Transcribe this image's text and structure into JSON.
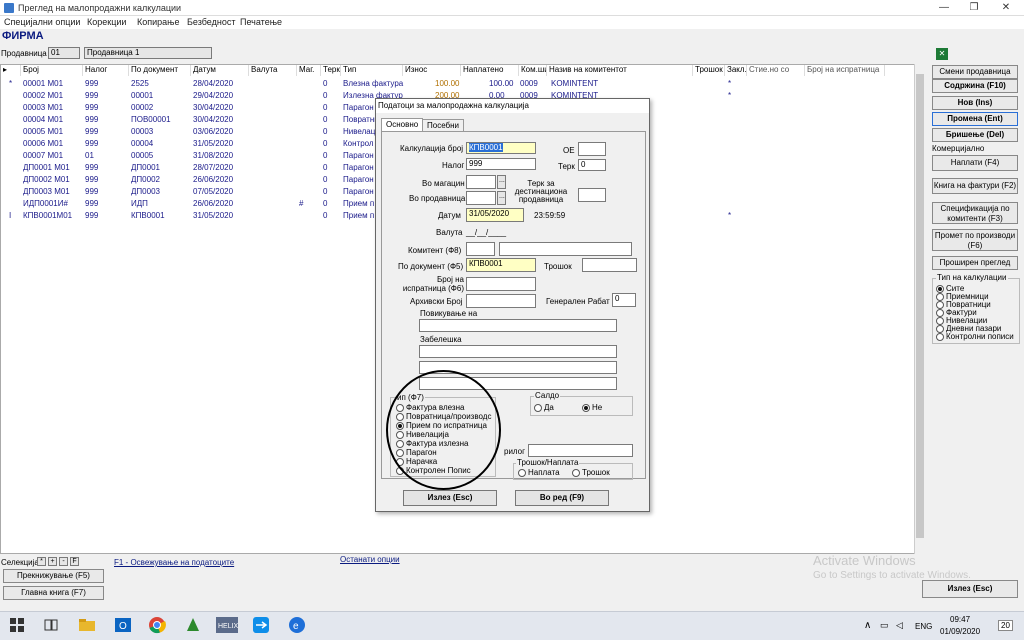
{
  "window": {
    "title": "Преглед на малопродажни калкулации",
    "minimize": "—",
    "maximize": "❐",
    "close": "✕"
  },
  "menu": [
    "Специјални опции",
    "Корекции",
    "Копирање",
    "Безбедност",
    "Печатење"
  ],
  "header": {
    "company": "ФИРМА",
    "store_label": "Продавница",
    "store_code": "01",
    "store_name": "Продавница 1"
  },
  "grid": {
    "columns": [
      "Број",
      "Налог",
      "По документ",
      "Датум",
      "Валута",
      "Маг.",
      "Терк",
      "Тип",
      "Износ",
      "Наплатено",
      "Ком.ши",
      "Назив на комитентот",
      "Трошок",
      "Закл.",
      "Стие.но со",
      "Број на испратница"
    ],
    "rows": [
      {
        "mark": "*",
        "broj": "00001 M01",
        "nalog": "999",
        "doc": "2525",
        "datum": "28/04/2020",
        "valuta": "",
        "mag": "",
        "terk": "0",
        "tip": "Влезна фактура",
        "iznos": "100.00",
        "naplateno": "100.00",
        "kom": "0009",
        "naziv": "KOMINTENT",
        "zakl": "*"
      },
      {
        "mark": "",
        "broj": "00002 M01",
        "nalog": "999",
        "doc": "00001",
        "datum": "29/04/2020",
        "valuta": "",
        "mag": "",
        "terk": "0",
        "tip": "Излезна фактур",
        "iznos": "200.00",
        "naplateno": "0.00",
        "kom": "0009",
        "naziv": "KOMINTENT",
        "zakl": "*"
      },
      {
        "mark": "",
        "broj": "00003 M01",
        "nalog": "999",
        "doc": "00002",
        "datum": "30/04/2020",
        "valuta": "",
        "mag": "",
        "terk": "0",
        "tip": "Парагон",
        "iznos": "",
        "naplateno": "",
        "kom": "",
        "naziv": "",
        "zakl": ""
      },
      {
        "mark": "",
        "broj": "00004 M01",
        "nalog": "999",
        "doc": "ПОВ00001",
        "datum": "30/04/2020",
        "valuta": "",
        "mag": "",
        "terk": "0",
        "tip": "Повратни",
        "iznos": "",
        "naplateno": "",
        "kom": "",
        "naziv": "",
        "zakl": ""
      },
      {
        "mark": "",
        "broj": "00005 M01",
        "nalog": "999",
        "doc": "00003",
        "datum": "03/06/2020",
        "valuta": "",
        "mag": "",
        "terk": "0",
        "tip": "Нивелаци",
        "iznos": "",
        "naplateno": "",
        "kom": "",
        "naziv": "",
        "zakl": ""
      },
      {
        "mark": "",
        "broj": "00006 M01",
        "nalog": "999",
        "doc": "00004",
        "datum": "31/05/2020",
        "valuta": "",
        "mag": "",
        "terk": "0",
        "tip": "Контрол",
        "iznos": "",
        "naplateno": "",
        "kom": "",
        "naziv": "",
        "zakl": ""
      },
      {
        "mark": "",
        "broj": "00007 M01",
        "nalog": "01",
        "doc": "00005",
        "datum": "31/08/2020",
        "valuta": "",
        "mag": "",
        "terk": "0",
        "tip": "Парагон",
        "iznos": "",
        "naplateno": "",
        "kom": "",
        "naziv": "",
        "zakl": ""
      },
      {
        "mark": "",
        "broj": "ДП0001 M01",
        "nalog": "999",
        "doc": "ДП0001",
        "datum": "28/07/2020",
        "valuta": "",
        "mag": "",
        "terk": "0",
        "tip": "Парагон",
        "iznos": "",
        "naplateno": "",
        "kom": "",
        "naziv": "",
        "zakl": ""
      },
      {
        "mark": "",
        "broj": "ДП0002 M01",
        "nalog": "999",
        "doc": "ДП0002",
        "datum": "26/06/2020",
        "valuta": "",
        "mag": "",
        "terk": "0",
        "tip": "Парагон",
        "iznos": "",
        "naplateno": "",
        "kom": "",
        "naziv": "",
        "zakl": ""
      },
      {
        "mark": "",
        "broj": "ДП0003 M01",
        "nalog": "999",
        "doc": "ДП0003",
        "datum": "07/05/2020",
        "valuta": "",
        "mag": "",
        "terk": "0",
        "tip": "Парагон",
        "iznos": "",
        "naplateno": "",
        "kom": "",
        "naziv": "",
        "zakl": ""
      },
      {
        "mark": "",
        "broj": "ИДП0001И#",
        "nalog": "999",
        "doc": "ИДП",
        "datum": "26/06/2020",
        "valuta": "",
        "mag": "#",
        "terk": "0",
        "tip": "Прием п",
        "iznos": "",
        "naplateno": "",
        "kom": "",
        "naziv": "",
        "zakl": ""
      },
      {
        "mark": "I",
        "broj": "КПВ0001M01",
        "nalog": "999",
        "doc": "КПВ0001",
        "datum": "31/05/2020",
        "valuta": "",
        "mag": "",
        "terk": "0",
        "tip": "Прием п",
        "iznos": "",
        "naplateno": "",
        "kom": "",
        "naziv": "",
        "zakl": "*"
      }
    ]
  },
  "right_panel": {
    "buttons": [
      "Смени продавница",
      "Содржина (F10)",
      "Нов (Ins)",
      "Промена (Ent)",
      "Бришење (Del)"
    ],
    "section_label": "Комерцијално",
    "buttons2": [
      "Наплати (F4)",
      "Книга на фактури (F2)",
      "Спецификација по комитенти (F3)",
      "Промет по производи (F6)",
      "Проширен преглед"
    ],
    "filter_title": "Тип на калкулации",
    "filters": [
      "Сите",
      "Приемници",
      "Повратници",
      "Фактури",
      "Нивелации",
      "Дневни пазари",
      "Контролни пописи"
    ]
  },
  "dialog": {
    "title": "Податоци за малопродажна калкулација",
    "tabs": [
      "Основно",
      "Посебни"
    ],
    "fields": {
      "kalk_label": "Калкулација број",
      "kalk_value": "КПВ0001",
      "oe_label": "OE",
      "nalog_label": "Налог",
      "nalog_value": "999",
      "terk_label": "Терк",
      "terk_value": "0",
      "vo_magacin_label": "Во магацин",
      "vo_prod_label": "Во продавница",
      "terk_dest_label": "Терк за дестинациона продавница",
      "datum_label": "Датум",
      "datum_value": "31/05/2020",
      "time_value": "23:59:59",
      "valuta_label": "Валута",
      "valuta_value": "__/__/____",
      "komitent_label": "Комитент (Ф8)",
      "po_doc_label": "По документ (Ф5)",
      "po_doc_value": "КПВ0001",
      "trosok_label": "Трошок",
      "ispr_label": "Број на испратница (Ф6)",
      "arh_label": "Архивски Број",
      "rabat_label": "Генерален Рабат",
      "rabat_value": "0",
      "poviku_label": "Повикување на",
      "zabel_label": "Забелешка",
      "prilog_label": "рилог"
    },
    "tip_title": "ип (Ф7)",
    "tip_options": [
      "Фактура влезна",
      "Повратница/производс",
      "Прием по испратница",
      "Нивелација",
      "Фактура излезна",
      "Парагон",
      "Нарачка",
      "Контролен Попис"
    ],
    "saldo_title": "Салдо",
    "saldo_yes": "Да",
    "saldo_no": "Не",
    "trosok_title": "Трошок/Наплата",
    "trosok_opt1": "Наплата",
    "trosok_opt2": "Трошок",
    "exit_btn": "Излез (Esc)",
    "ok_btn": "Во ред (F9)"
  },
  "bottom": {
    "selection_label": "Селекција",
    "sel_btns": [
      "*",
      "+",
      "-",
      "F"
    ],
    "refresh_link": "F1 - Освежување на податоците",
    "other_link": "Останати опции",
    "btn1": "Прекнижување (F5)",
    "btn2": "Главна книга (F7)",
    "exit": "Излез (Esc)",
    "activate": "Activate Windows",
    "activate_sub": "Go to Settings to activate Windows."
  },
  "taskbar": {
    "lang": "ENG",
    "time": "09:47",
    "date": "01/09/2020",
    "notif": "20"
  }
}
